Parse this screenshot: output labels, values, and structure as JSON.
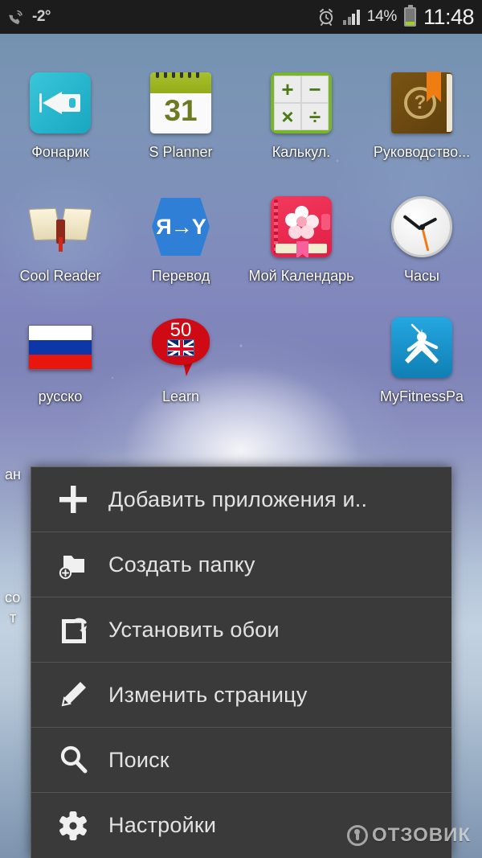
{
  "status_bar": {
    "call_icon": "missed-call-icon",
    "temperature": "-2°",
    "alarm_icon": "alarm-clock-icon",
    "signal_icon": "signal-bars-icon",
    "battery_percent": "14%",
    "battery_icon": "battery-icon",
    "clock": "11:48"
  },
  "home_screen": {
    "rows": [
      {
        "apps": [
          {
            "label": "Фонарик",
            "icon": "flashlight-icon"
          },
          {
            "label": "S Planner",
            "icon": "calendar-icon",
            "badge": "31"
          },
          {
            "label": "Калькул.",
            "icon": "calculator-icon",
            "keys": [
              "+",
              "−",
              "×",
              "÷"
            ]
          },
          {
            "label": "Руководство...",
            "icon": "guide-book-icon",
            "glyph": "?"
          }
        ]
      },
      {
        "apps": [
          {
            "label": "Cool Reader",
            "icon": "open-book-icon"
          },
          {
            "label": "Перевод",
            "icon": "translate-icon",
            "glyph": "Я→Y"
          },
          {
            "label": "Мой Календарь",
            "icon": "diary-icon"
          },
          {
            "label": "Часы",
            "icon": "analog-clock-icon"
          }
        ]
      },
      {
        "apps": [
          {
            "label": "русско",
            "icon": "russian-flag-icon"
          },
          {
            "label": "Learn",
            "icon": "learn-bubble-icon",
            "badge": "50"
          },
          {
            "label": "",
            "icon": ""
          },
          {
            "label": "MyFitnessPa",
            "icon": "myfitnesspal-icon"
          }
        ]
      }
    ],
    "obscured_labels": [
      "ан",
      "со",
      "т"
    ]
  },
  "context_menu": {
    "items": [
      {
        "label": "Добавить приложения и..",
        "icon": "plus-icon"
      },
      {
        "label": "Создать папку",
        "icon": "new-folder-icon"
      },
      {
        "label": "Установить обои",
        "icon": "set-wallpaper-icon"
      },
      {
        "label": "Изменить страницу",
        "icon": "edit-pencil-icon"
      },
      {
        "label": "Поиск",
        "icon": "search-icon"
      },
      {
        "label": "Настройки",
        "icon": "settings-gear-icon"
      }
    ]
  },
  "watermark": {
    "text": "ОТЗОВИК",
    "icon": "otzovik-logo-icon"
  },
  "colors": {
    "status_bar_bg": "#1c1c1c",
    "menu_bg": "#3a3a3a",
    "menu_text": "#e3e3e3",
    "menu_divider": "#555555",
    "battery_green": "#9fd220",
    "accent_red": "#cf0a15"
  }
}
